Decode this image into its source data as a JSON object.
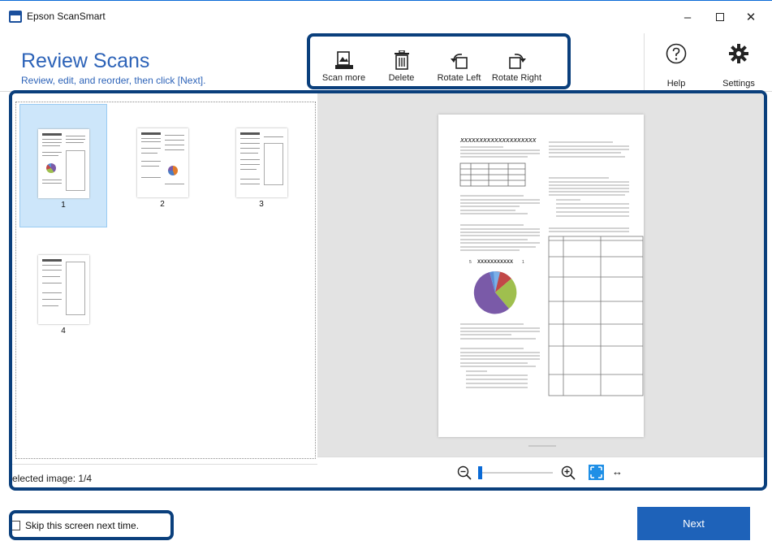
{
  "window": {
    "title": "Epson ScanSmart",
    "controls": {
      "minimize": "–",
      "close": "✕"
    }
  },
  "header": {
    "title": "Review Scans",
    "subtitle": "Review, edit, and reorder, then click [Next]."
  },
  "toolbar": {
    "items": [
      {
        "label": "Scan more",
        "icon": "scan-more-icon"
      },
      {
        "label": "Delete",
        "icon": "trash-icon"
      },
      {
        "label": "Rotate Left",
        "icon": "rotate-left-icon"
      },
      {
        "label": "Rotate Right",
        "icon": "rotate-right-icon"
      }
    ],
    "help_label": "Help",
    "settings_label": "Settings"
  },
  "thumbnails": [
    {
      "number": "1",
      "selected": true
    },
    {
      "number": "2",
      "selected": false
    },
    {
      "number": "3",
      "selected": false
    },
    {
      "number": "4",
      "selected": false
    }
  ],
  "status": {
    "selected_image": "elected image: 1/4"
  },
  "preview": {
    "heading": "XXXXXXXXXXXXXXXXXXXX",
    "chart_label": "XXXXXXXXXXX",
    "pie_labels": [
      "5",
      "1"
    ]
  },
  "zoom": {
    "fit_icon": "fit-to-page-icon",
    "width_icon": "↔"
  },
  "footer": {
    "skip_label": "Skip this screen next time.",
    "skip_checked": false,
    "next_label": "Next"
  },
  "colors": {
    "accent": "#2d63b8",
    "highlight_border": "#0a3f7c",
    "selection": "#cde6fa",
    "next_button": "#1e62b9"
  }
}
